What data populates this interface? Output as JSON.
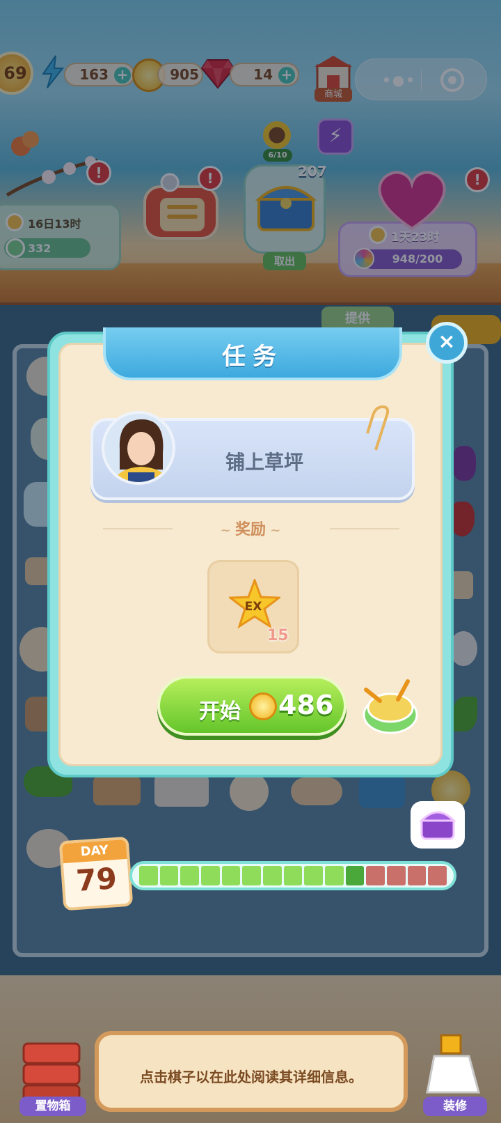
{
  "resources": {
    "level": "69",
    "energy": "163",
    "coins": "905",
    "gems": "14",
    "shop_label": "商城"
  },
  "events": {
    "timer_left": "16日13时",
    "left_count": "332",
    "sunflower_progress": "6/10",
    "chest_count": "207",
    "chest_label": "取出",
    "timer_right": "1天23时",
    "right_progress": "948/200",
    "provide_label": "提供"
  },
  "modal": {
    "title": "任务",
    "close_symbol": "×",
    "task_text": "铺上草坪",
    "reward_label": "奖励",
    "reward_icon_text": "EX",
    "reward_count": "15",
    "start_label": "开始",
    "start_price": "486"
  },
  "day": {
    "label": "DAY",
    "number": "79",
    "segments_total": 15,
    "segments_done": 10,
    "segments_current": 1
  },
  "bottom": {
    "info_text": "点击棋子以在此处阅读其详细信息。",
    "storage_label": "置物箱",
    "decorate_label": "装修"
  },
  "colors": {
    "accent_green": "#64c52a",
    "modal_border": "#8ee3e0",
    "title_blue": "#3ea9de",
    "segment_done": "#8fdc5a",
    "segment_current": "#4aa83a",
    "segment_todo": "#c9706a"
  }
}
